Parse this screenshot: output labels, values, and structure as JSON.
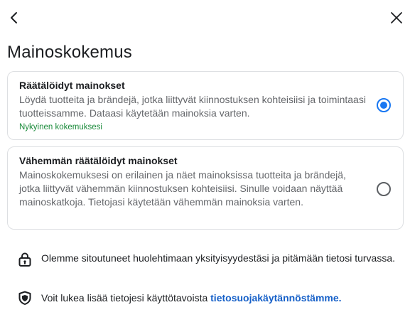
{
  "header": {
    "back_icon": "chevron-left-icon",
    "close_icon": "close-icon",
    "title": "Mainoskokemus"
  },
  "options": [
    {
      "title": "Räätälöidyt mainokset",
      "description": "Löydä tuotteita ja brändejä, jotka liittyvät kiinnostuksen kohteisiisi ja toimintaasi tuotteissamme. Dataasi käytetään mainoksia varten.",
      "current_label": "Nykyinen kokemuksesi",
      "selected": true
    },
    {
      "title": "Vähemmän räätälöidyt mainokset",
      "description": "Mainoskokemuksesi on erilainen ja näet mainoksissa tuotteita ja brändejä, jotka liittyvät vähemmän kiinnostuksen kohteisiisi. Sinulle voidaan näyttää mainoskatkoja. Tietojasi käytetään vähemmän mainoksia varten.",
      "selected": false
    }
  ],
  "info": {
    "privacy_text": "Olemme sitoutuneet huolehtimaan yksityisyydestäsi ja pitämään tietosi turvassa.",
    "privacy_icon": "lock-icon",
    "policy_text": "Voit lukea lisää tietojesi käyttötavoista ",
    "policy_link": "tietosuojakäytännöstämme.",
    "policy_icon": "shield-icon"
  },
  "colors": {
    "accent": "#1877f2",
    "current_green": "#1a8a3a",
    "link": "#1660c8"
  }
}
